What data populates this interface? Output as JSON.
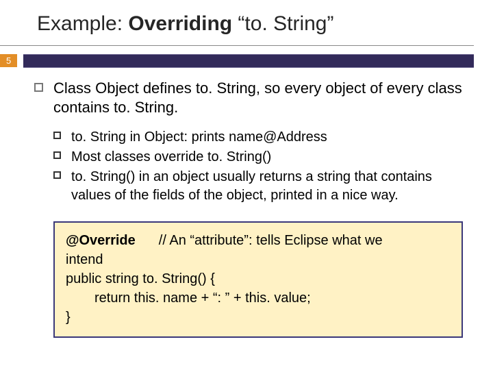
{
  "page_number": "5",
  "title_a": "Example: ",
  "title_b": "Overriding",
  "title_c": " “to. String”",
  "l1": "Class Object defines to. String, so every object of every class contains to. String.",
  "sub": [
    "to. String in Object: prints name@Address",
    "Most classes override to. String()",
    "to. String() in an object usually returns a string that contains values of the fields of the object, printed in a nice way."
  ],
  "code": {
    "line1a": "@Override",
    "line1b": "// An “attribute”: tells Eclipse what we",
    "line2": "intend",
    "line3": "public string to. String() {",
    "line4": "return this. name + “: ” + this. value;",
    "line5": "}"
  }
}
